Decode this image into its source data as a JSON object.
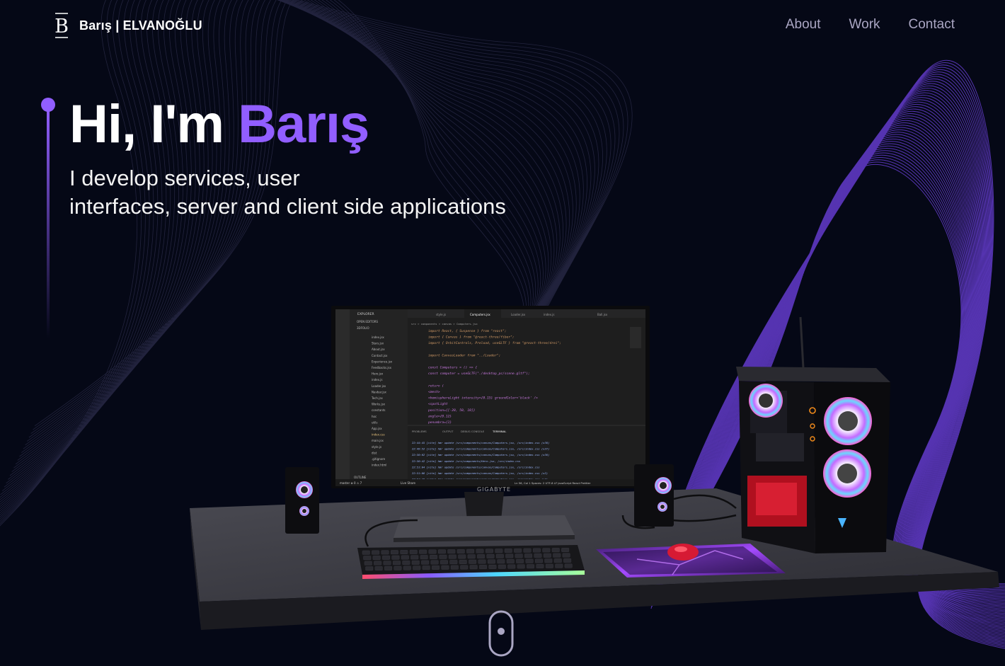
{
  "nav": {
    "brand": "Barış | ELVANOĞLU",
    "logo_letter": "B",
    "links": [
      {
        "label": "About"
      },
      {
        "label": "Work"
      },
      {
        "label": "Contact"
      }
    ]
  },
  "hero": {
    "greeting": "Hi, I'm ",
    "name": "Barış",
    "subtitle_line1": "I develop services, user",
    "subtitle_line2": "interfaces, server and client side applications"
  },
  "computer": {
    "monitor_brand": "GIGABYTE",
    "editor": {
      "explorer_title": "EXPLORER",
      "open_editors": "OPEN EDITORS",
      "folder": "3DFOLIO",
      "files": [
        "index.jsx",
        "Stars.jsx",
        "About.jsx",
        "Contact.jsx",
        "Experience.jsx",
        "Feedbacks.jsx",
        "Hero.jsx",
        "index.js",
        "Loader.jsx",
        "Navbar.jsx",
        "Tech.jsx",
        "Works.jsx",
        "constants",
        "hoc",
        "utils",
        "App.jsx",
        "index.css",
        "main.jsx",
        "style.js",
        "dist",
        ".gitignore",
        "index.html"
      ],
      "outline": "OUTLINE",
      "tabs": [
        "style.js",
        "Computers.jsx",
        "Loader.jsx",
        "index.js",
        "Ball.jsx"
      ],
      "breadcrumb": "src > components > canvas > Computers.jsx",
      "code_lines": [
        "import React, { Suspense } from \"react\";",
        "import { Canvas } from \"@react-three/fiber\";",
        "import { OrbitControls, Preload, useGLTF } from \"@react-three/drei\";",
        "",
        "import CanvasLoader from \"../Loader\";",
        "",
        "const Computers = () => {",
        "  const computer = useGLTF(\"./desktop_pc/scene.gltf\");",
        "",
        "  return (",
        "    <mesh>",
        "      <hemisphereLight intensity={0.15} groundColor='black' />",
        "      <spotLight",
        "        position={[-20, 50, 10]}",
        "        angle={0.12}",
        "        penumbra={1}"
      ],
      "panel_tabs": [
        "PROBLEMS",
        "OUTPUT",
        "DEBUG CONSOLE",
        "TERMINAL"
      ],
      "terminal_lines": [
        "22:44:45 [vite] hmr update /src/components/canvas/Computers.jsx, /src/index.css (x36)",
        "22:49:52 [vite] hmr update /src/components/canvas/Computers.jsx, /src/index.css (x37)",
        "22:50:02 [vite] hmr update /src/components/canvas/Computers.jsx, /src/index.css (x38)",
        "22:50:42 [vite] hmr update /src/components/Hero.jsx, /src/index.css",
        "22:51:04 [vite] hmr update /src/components/canvas/Computers.jsx, /src/index.css",
        "22:51:08 [vite] hmr update /src/components/canvas/Computers.jsx, /src/index.css (x2)",
        "22:51:40 [vite] hmr update /src/components/canvas/Computers.jsx, /src/index.css (x3)"
      ],
      "status_left": "master  ⊗ 0 ⚠ 7",
      "status_live": "Live Share",
      "status_right": "Ln 56, Col 1   Spaces: 2   UTF-8   LF   JavaScript React   Prettier"
    }
  },
  "colors": {
    "background": "#050816",
    "accent": "#915eff",
    "nav_text": "#aaa6c3",
    "white": "#ffffff"
  },
  "icons": {
    "logo": "logo-b-icon",
    "scroll": "mouse-scroll-icon"
  }
}
